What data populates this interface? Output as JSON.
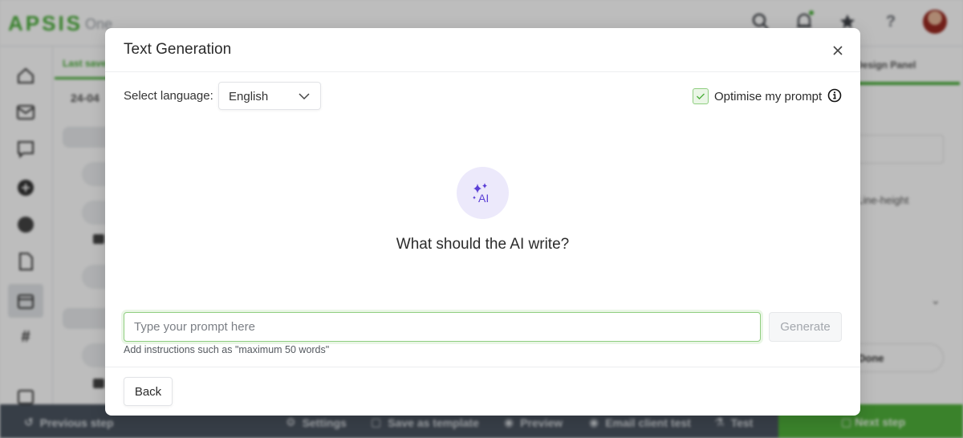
{
  "app": {
    "logo": "APSIS",
    "logo_sub": "One",
    "top_icons": [
      "search-icon",
      "bell-icon",
      "star-icon",
      "help-icon",
      "avatar"
    ],
    "sidebar_icons": [
      "home-icon",
      "mail-icon",
      "chat-icon",
      "plus-circle-icon",
      "globe-icon",
      "document-icon",
      "calendar-icon",
      "hash-icon",
      "calendar-bottom-icon"
    ],
    "left_panel": {
      "tab": "Last saved",
      "date": "24-04"
    },
    "right_panel": {
      "tab": "Design Panel",
      "label": "Line-height",
      "button": "Done"
    },
    "bottom_bar": {
      "previous": "Previous step",
      "settings": "Settings",
      "save_template": "Save as template",
      "preview": "Preview",
      "email_client_test": "Email client test",
      "test": "Test",
      "next": "Next step"
    },
    "colors": {
      "brand_green": "#4caf3c",
      "bottom_bar": "#4b5460",
      "ai_purple": "#5b3fd6"
    }
  },
  "modal": {
    "title": "Text Generation",
    "close_label": "×",
    "language_label": "Select language:",
    "language_value": "English",
    "optimise_label": "Optimise my prompt",
    "optimise_checked": true,
    "ai_icon_text": "AI",
    "question": "What should the AI write?",
    "prompt_placeholder": "Type your prompt here",
    "prompt_value": "",
    "generate_label": "Generate",
    "hint": "Add instructions such as \"maximum 50 words\"",
    "back_label": "Back"
  }
}
